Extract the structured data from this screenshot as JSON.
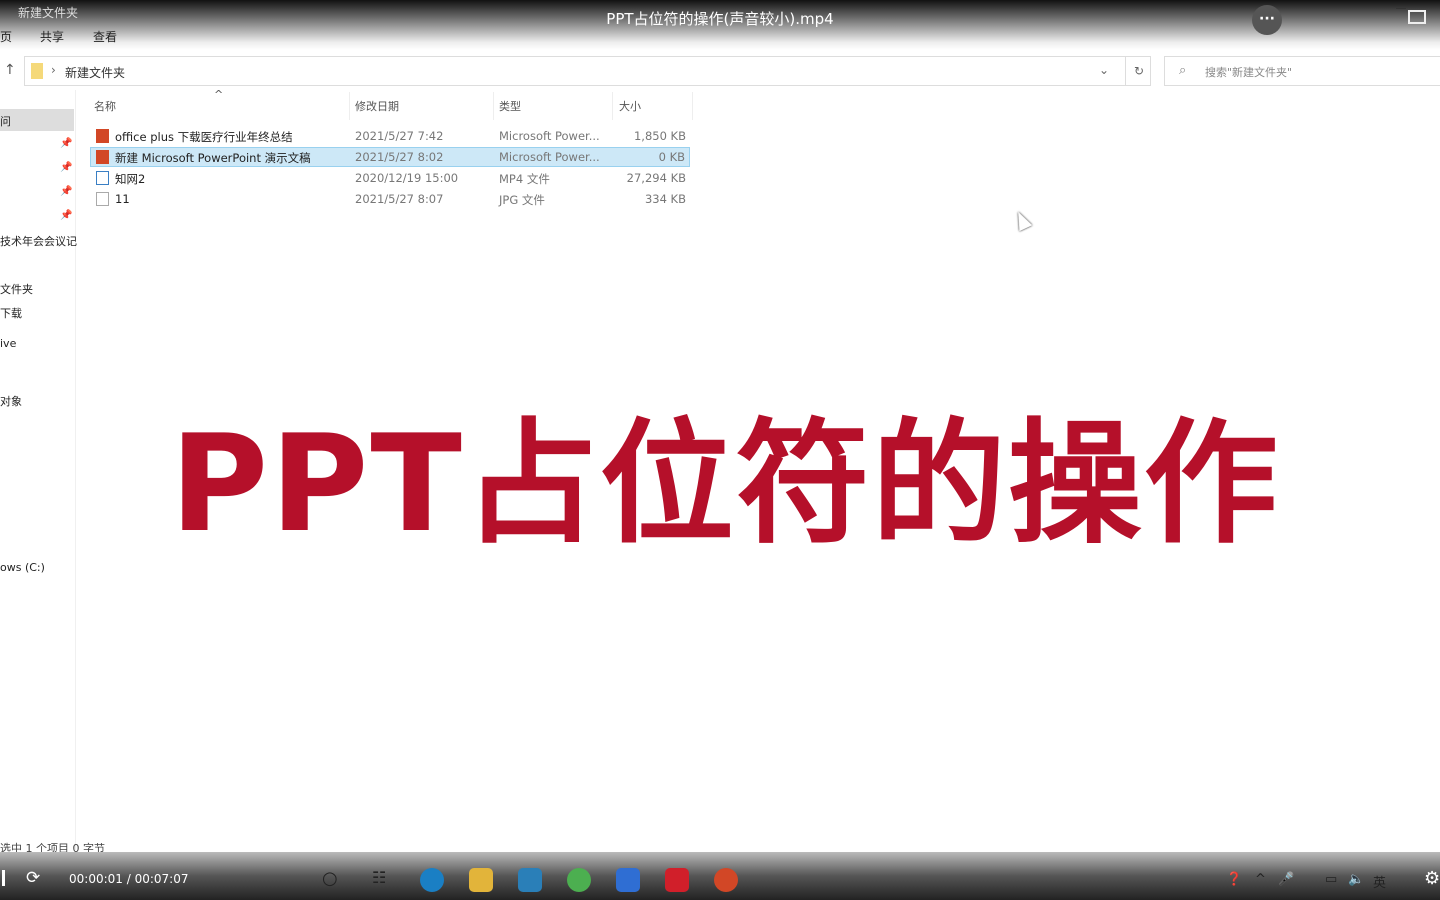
{
  "player": {
    "title": "PPT占位符的操作(声音较小).mp4",
    "more_label": "···",
    "time": "00:00:01 / 00:07:07"
  },
  "explorer": {
    "breadcrumb_top": "新建文件夹",
    "ribbon": [
      "页",
      "共享",
      "查看"
    ],
    "address": "新建文件夹",
    "search_placeholder": "搜索\"新建文件夹\"",
    "nav": [
      "问",
      "技术年会会议记",
      "文件夹",
      "下载",
      "ive",
      "对象",
      "ows (C:)"
    ],
    "columns": {
      "name": "名称",
      "date": "修改日期",
      "type": "类型",
      "size": "大小"
    },
    "files": [
      {
        "name": "office plus 下载医疗行业年终总结",
        "date": "2021/5/27 7:42",
        "type": "Microsoft Power...",
        "size": "1,850 KB",
        "icon": "ppt-icon"
      },
      {
        "name": "新建 Microsoft PowerPoint 演示文稿",
        "date": "2021/5/27 8:02",
        "type": "Microsoft Power...",
        "size": "0 KB",
        "icon": "ppt-icon",
        "selected": true
      },
      {
        "name": "知网2",
        "date": "2020/12/19 15:00",
        "type": "MP4 文件",
        "size": "27,294 KB",
        "icon": "video-file-icon"
      },
      {
        "name": "11",
        "date": "2021/5/27 8:07",
        "type": "JPG 文件",
        "size": "334 KB",
        "icon": "image-file-icon"
      }
    ],
    "status": "选中 1 个项目  0 字节"
  },
  "overlay": {
    "text": "PPT占位符的操作",
    "color": "#b5102a"
  },
  "taskbar": {
    "tray_lang": "英"
  }
}
